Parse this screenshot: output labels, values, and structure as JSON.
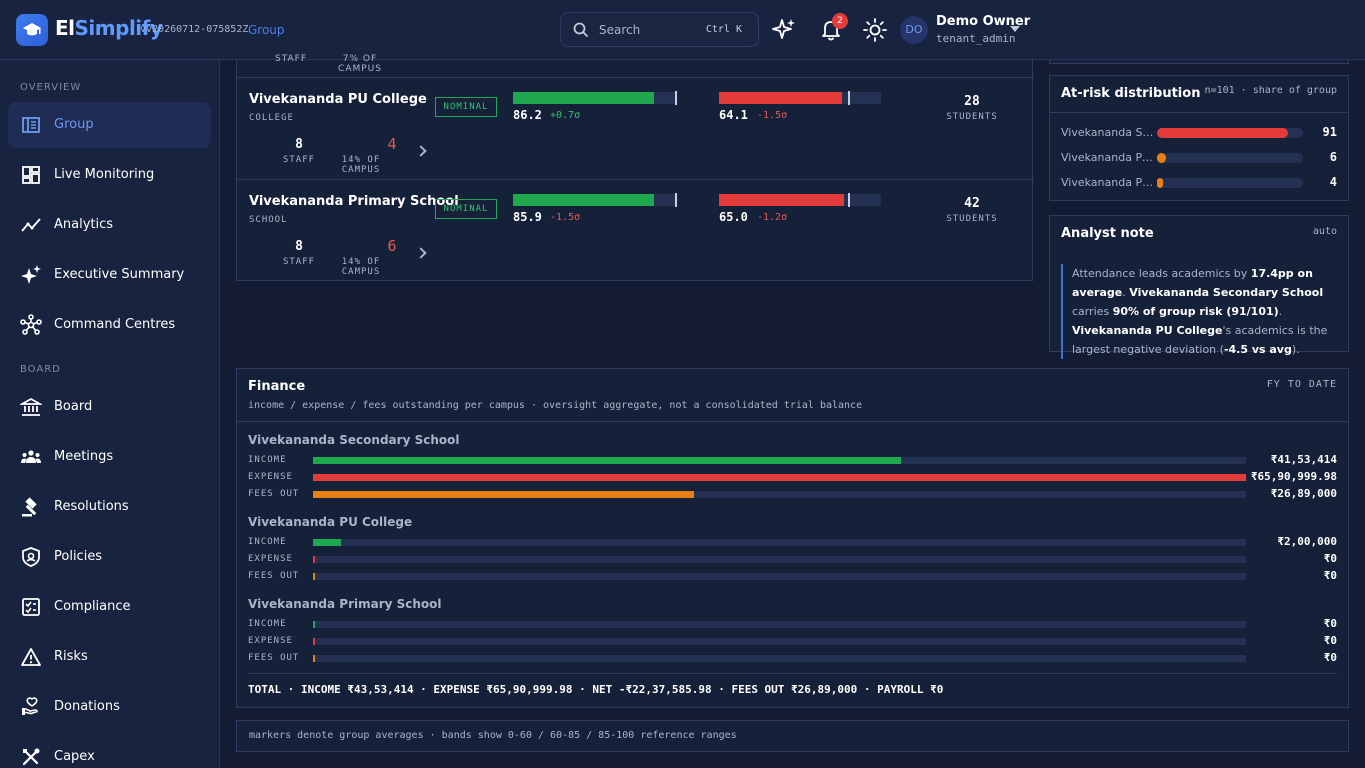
{
  "app": {
    "brand_a": "El",
    "brand_b": "Simplify",
    "version": "vv20260712-075852Z",
    "context_link": "Group"
  },
  "search": {
    "placeholder": "Search",
    "shortcut": "Ctrl K"
  },
  "notifications": {
    "count": "2"
  },
  "user": {
    "initials": "DO",
    "name": "Demo Owner",
    "role": "tenant_admin"
  },
  "sidebar": {
    "sections": [
      {
        "label": "OVERVIEW",
        "items": [
          {
            "label": "Group",
            "icon": "group-icon",
            "active": true
          },
          {
            "label": "Live Monitoring",
            "icon": "dashboard-icon"
          },
          {
            "label": "Analytics",
            "icon": "trend-icon"
          },
          {
            "label": "Executive Summary",
            "icon": "sparkle-icon"
          },
          {
            "label": "Command Centres",
            "icon": "network-icon"
          }
        ]
      },
      {
        "label": "BOARD",
        "items": [
          {
            "label": "Board",
            "icon": "bank-icon"
          },
          {
            "label": "Meetings",
            "icon": "people-icon"
          },
          {
            "label": "Resolutions",
            "icon": "gavel-icon"
          },
          {
            "label": "Policies",
            "icon": "shield-icon"
          },
          {
            "label": "Compliance",
            "icon": "checklist-icon"
          },
          {
            "label": "Risks",
            "icon": "warning-icon"
          },
          {
            "label": "Donations",
            "icon": "donation-icon"
          },
          {
            "label": "Capex",
            "icon": "tools-icon"
          }
        ]
      }
    ]
  },
  "campus_table": {
    "partial_row": {
      "staff_label": "STAFF",
      "campus_label": "7% OF CAMPUS"
    },
    "rows": [
      {
        "name": "Vivekananda PU College",
        "type": "COLLEGE",
        "status": "NOMINAL",
        "attendance": {
          "value": "86.2",
          "delta": "+0.7σ",
          "fill_pct": 86.2
        },
        "academics": {
          "value": "64.1",
          "delta": "-1.5σ",
          "fill_pct": 75.6
        },
        "students": "28",
        "students_label": "STUDENTS",
        "staff": "8",
        "staff_label": "STAFF",
        "at_risk": "4",
        "campus_share": "14% OF CAMPUS"
      },
      {
        "name": "Vivekananda Primary School",
        "type": "SCHOOL",
        "status": "NOMINAL",
        "attendance": {
          "value": "85.9",
          "delta": "-1.5σ",
          "fill_pct": 85.9
        },
        "academics": {
          "value": "65.0",
          "delta": "-1.2σ",
          "fill_pct": 76.9
        },
        "students": "42",
        "students_label": "STUDENTS",
        "staff": "8",
        "staff_label": "STAFF",
        "at_risk": "6",
        "campus_share": "14% OF CAMPUS"
      }
    ]
  },
  "at_risk": {
    "title": "At-risk distribution",
    "subtitle": "n=101 · share of group",
    "items": [
      {
        "label": "Vivekananda Secondary School",
        "value": "91",
        "share": 0.9,
        "color": "#e33a3a"
      },
      {
        "label": "Vivekananda Primary School",
        "value": "6",
        "share": 0.06,
        "color": "#e87f12"
      },
      {
        "label": "Vivekananda PU College",
        "value": "4",
        "share": 0.04,
        "color": "#e87f12"
      }
    ]
  },
  "analyst_note": {
    "title": "Analyst note",
    "mode": "auto",
    "t1": "Attendance leads academics by ",
    "b1": "17.4pp on average",
    "t2": ". ",
    "b2": "Vivekananda Secondary School",
    "t3": " carries ",
    "b3": "90% of group risk (91/101)",
    "t4": ". ",
    "b4": "Vivekananda PU College",
    "t5": "'s academics is the largest negative deviation (",
    "b5": "-4.5 vs avg",
    "t6": ")."
  },
  "finance": {
    "title": "Finance",
    "subtitle": "income / expense / fees outstanding per campus · oversight aggregate, not a consolidated trial balance",
    "range": "FY TO DATE",
    "schools": [
      {
        "name": "Vivekananda Secondary School",
        "rows": [
          {
            "label": "INCOME",
            "value": "₹41,53,414",
            "share": 0.63,
            "color": "#1fa84e"
          },
          {
            "label": "EXPENSE",
            "value": "₹65,90,999.98",
            "share": 1.0,
            "color": "#e33a3a"
          },
          {
            "label": "FEES OUT",
            "value": "₹26,89,000",
            "share": 0.408,
            "color": "#e87f12"
          }
        ]
      },
      {
        "name": "Vivekananda PU College",
        "rows": [
          {
            "label": "INCOME",
            "value": "₹2,00,000",
            "share": 0.03,
            "color": "#1fa84e"
          },
          {
            "label": "EXPENSE",
            "value": "₹0",
            "share": 0.002,
            "color": "#e33a3a"
          },
          {
            "label": "FEES OUT",
            "value": "₹0",
            "share": 0.002,
            "color": "#e87f12"
          }
        ]
      },
      {
        "name": "Vivekananda Primary School",
        "rows": [
          {
            "label": "INCOME",
            "value": "₹0",
            "share": 0.002,
            "color": "#1fa84e"
          },
          {
            "label": "EXPENSE",
            "value": "₹0",
            "share": 0.002,
            "color": "#e33a3a"
          },
          {
            "label": "FEES OUT",
            "value": "₹0",
            "share": 0.002,
            "color": "#e87f12"
          }
        ]
      }
    ],
    "total": "TOTAL · INCOME ₹43,53,414 · EXPENSE ₹65,90,999.98 · NET -₹22,37,585.98 · FEES OUT ₹26,89,000 · PAYROLL ₹0"
  },
  "footer_note": "markers denote group averages · bands show 0-60 / 60-85 / 85-100 reference ranges",
  "colors": {
    "accent": "#3d7cf0",
    "good": "#1fa84e",
    "bad": "#e33a3a",
    "warn": "#e87f12"
  }
}
